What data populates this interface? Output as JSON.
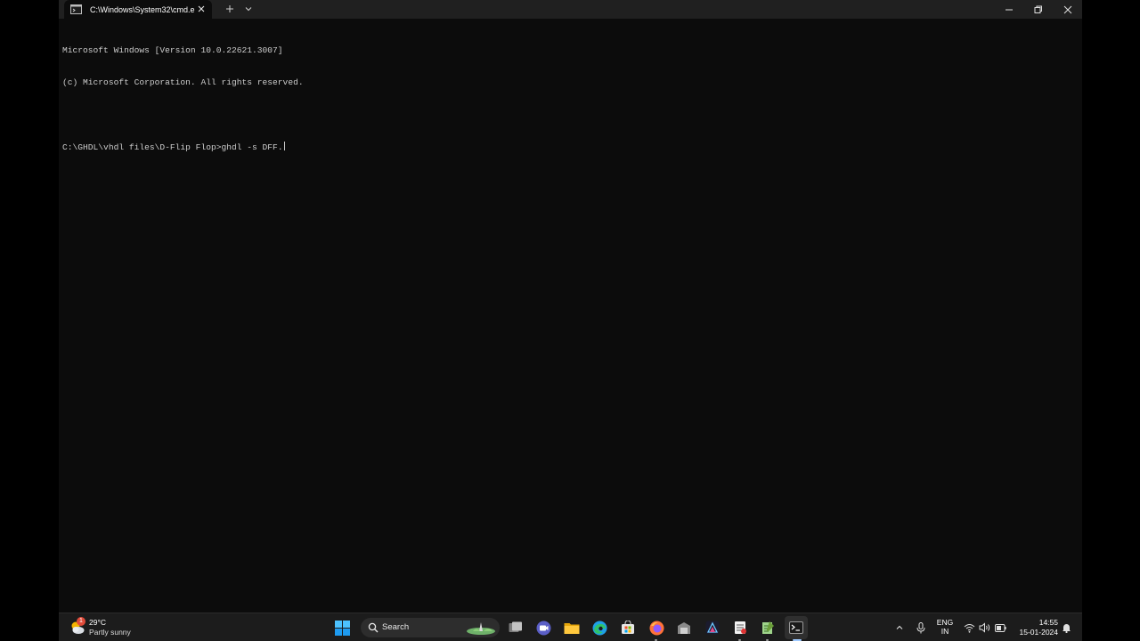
{
  "window": {
    "tab_title": "C:\\Windows\\System32\\cmd.e"
  },
  "console": {
    "line1": "Microsoft Windows [Version 10.0.22621.3007]",
    "line2": "(c) Microsoft Corporation. All rights reserved.",
    "prompt": "C:\\GHDL\\vhdl files\\D-Flip Flop>",
    "command": "ghdl -s DFF."
  },
  "taskbar": {
    "weather_badge": "1",
    "temperature": "29°C",
    "condition": "Partly sunny",
    "search_label": "Search",
    "apps": [
      "start-icon",
      "search-icon",
      "task-view-icon",
      "teams-icon",
      "file-explorer-icon",
      "edge-icon",
      "store-icon",
      "firefox-icon",
      "app-icon",
      "affinity-icon",
      "document-icon",
      "notepad-icon",
      "terminal-icon"
    ],
    "lang_line1": "ENG",
    "lang_line2": "IN",
    "time": "14:55",
    "date": "15-01-2024"
  },
  "colors": {
    "console_bg": "#0c0c0c",
    "console_text": "#cccccc",
    "titlebar_bg": "#202020",
    "taskbar_bg": "#1c1c1c"
  }
}
